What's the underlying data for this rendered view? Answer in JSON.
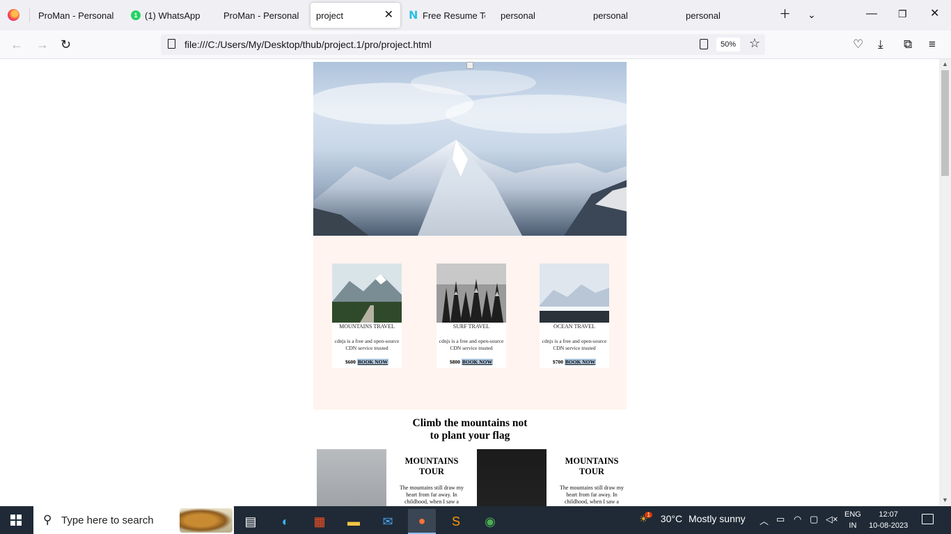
{
  "browser": {
    "tabs": [
      {
        "label": "ProMan - Personal P"
      },
      {
        "label": "(1) WhatsApp",
        "badge": "1"
      },
      {
        "label": "ProMan - Personal P"
      },
      {
        "label": "project"
      },
      {
        "label": "Free Resume Tem"
      },
      {
        "label": "personal"
      },
      {
        "label": "personal"
      },
      {
        "label": "personal"
      }
    ],
    "url": "file:///C:/Users/My/Desktop/thub/project.1/pro/project.html",
    "zoom": "50%"
  },
  "page": {
    "packages": [
      {
        "title": "MOUNTAINS TRAVEL",
        "desc": "cdnjs is a free and open-source CDN service trusted",
        "price": "$600",
        "cta": "BOOK NOW"
      },
      {
        "title": "SURF TRAVEL",
        "desc": "cdnjs is a free and open-source CDN service trusted",
        "price": "$800",
        "cta": "BOOK NOW"
      },
      {
        "title": "OCEAN TRAVEL",
        "desc": "cdnjs is a free and open-source CDN service trusted",
        "price": "$700",
        "cta": "BOOK NOW"
      }
    ],
    "tagline_line1": "Climb the mountains not",
    "tagline_line2": "to plant your flag",
    "tours": [
      {
        "title": "MOUNTAINS TOUR",
        "desc": "The mountains still draw my heart from far away. In childhood, when I saw a"
      },
      {
        "title": "MOUNTAINS TOUR",
        "desc": "The mountains still draw my heart from far away. In childhood, when I saw a"
      }
    ]
  },
  "taskbar": {
    "search_placeholder": "Type here to search",
    "weather_temp": "30°C",
    "weather_text": "Mostly sunny",
    "weather_badge": "1",
    "lang_top": "ENG",
    "lang_bottom": "IN",
    "time": "12:07",
    "date": "10-08-2023"
  },
  "colors": {
    "packages_bg": "#fff4ef",
    "book_now_bg": "#a9c3dc",
    "taskbar_bg": "#1f2a36"
  }
}
